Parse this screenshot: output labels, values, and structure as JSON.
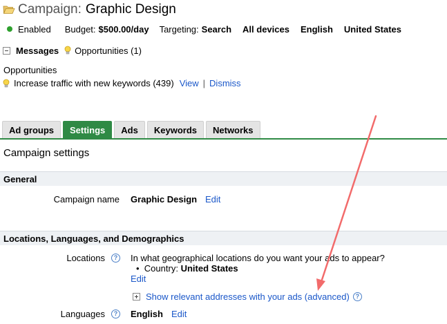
{
  "header": {
    "title_prefix": "Campaign:",
    "title_name": "Graphic Design"
  },
  "status": {
    "state": "Enabled",
    "budget_label": "Budget:",
    "budget_value": "$500.00/day",
    "targeting_label": "Targeting:",
    "targeting_network": "Search",
    "targeting_devices": "All devices",
    "targeting_language": "English",
    "targeting_location": "United States"
  },
  "messages": {
    "messages_label": "Messages",
    "opportunities_link": "Opportunities (1)"
  },
  "opportunities": {
    "title": "Opportunities",
    "text": "Increase traffic with new keywords (439)",
    "view_link": "View",
    "separator": "|",
    "dismiss_link": "Dismiss"
  },
  "tabs": [
    {
      "label": "Ad groups"
    },
    {
      "label": "Settings"
    },
    {
      "label": "Ads"
    },
    {
      "label": "Keywords"
    },
    {
      "label": "Networks"
    }
  ],
  "settings": {
    "section_title": "Campaign settings",
    "general_header": "General",
    "campaign_name_label": "Campaign name",
    "campaign_name_value": "Graphic Design",
    "edit_link": "Edit",
    "locations_header": "Locations, Languages, and Demographics",
    "locations_label": "Locations",
    "locations_question": "In what geographical locations do you want your ads to appear?",
    "country_label": "Country:",
    "country_value": "United States",
    "show_addresses_link": "Show relevant addresses with your ads (advanced)",
    "languages_label": "Languages",
    "languages_value": "English",
    "help_glyph": "?"
  },
  "colors": {
    "accent_green": "#2f8a45",
    "link_blue": "#1a57c9",
    "annotation_arrow": "#f26b6b"
  }
}
